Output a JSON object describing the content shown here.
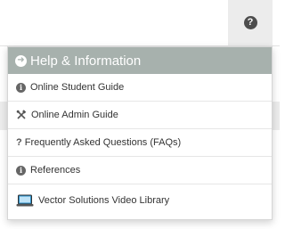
{
  "colors": {
    "header_bg": "#a7b1ad",
    "trigger_bg": "#ececec",
    "icon_dark": "#4d4d4d",
    "laptop_accent": "#2a8fc9"
  },
  "help_button": {
    "icon": "question-circle-icon",
    "glyph": "?"
  },
  "menu": {
    "header_icon": "arrow-circle-right-icon",
    "header_title": "Help & Information",
    "items": [
      {
        "icon": "info-circle-icon",
        "label": "Online Student Guide"
      },
      {
        "icon": "tools-icon",
        "label": "Online Admin Guide"
      },
      {
        "icon": "question-mark-icon",
        "label": "Frequently Asked Questions (FAQs)"
      },
      {
        "icon": "info-circle-icon",
        "label": "References"
      },
      {
        "icon": "laptop-icon",
        "label": "Vector Solutions Video Library"
      }
    ]
  }
}
